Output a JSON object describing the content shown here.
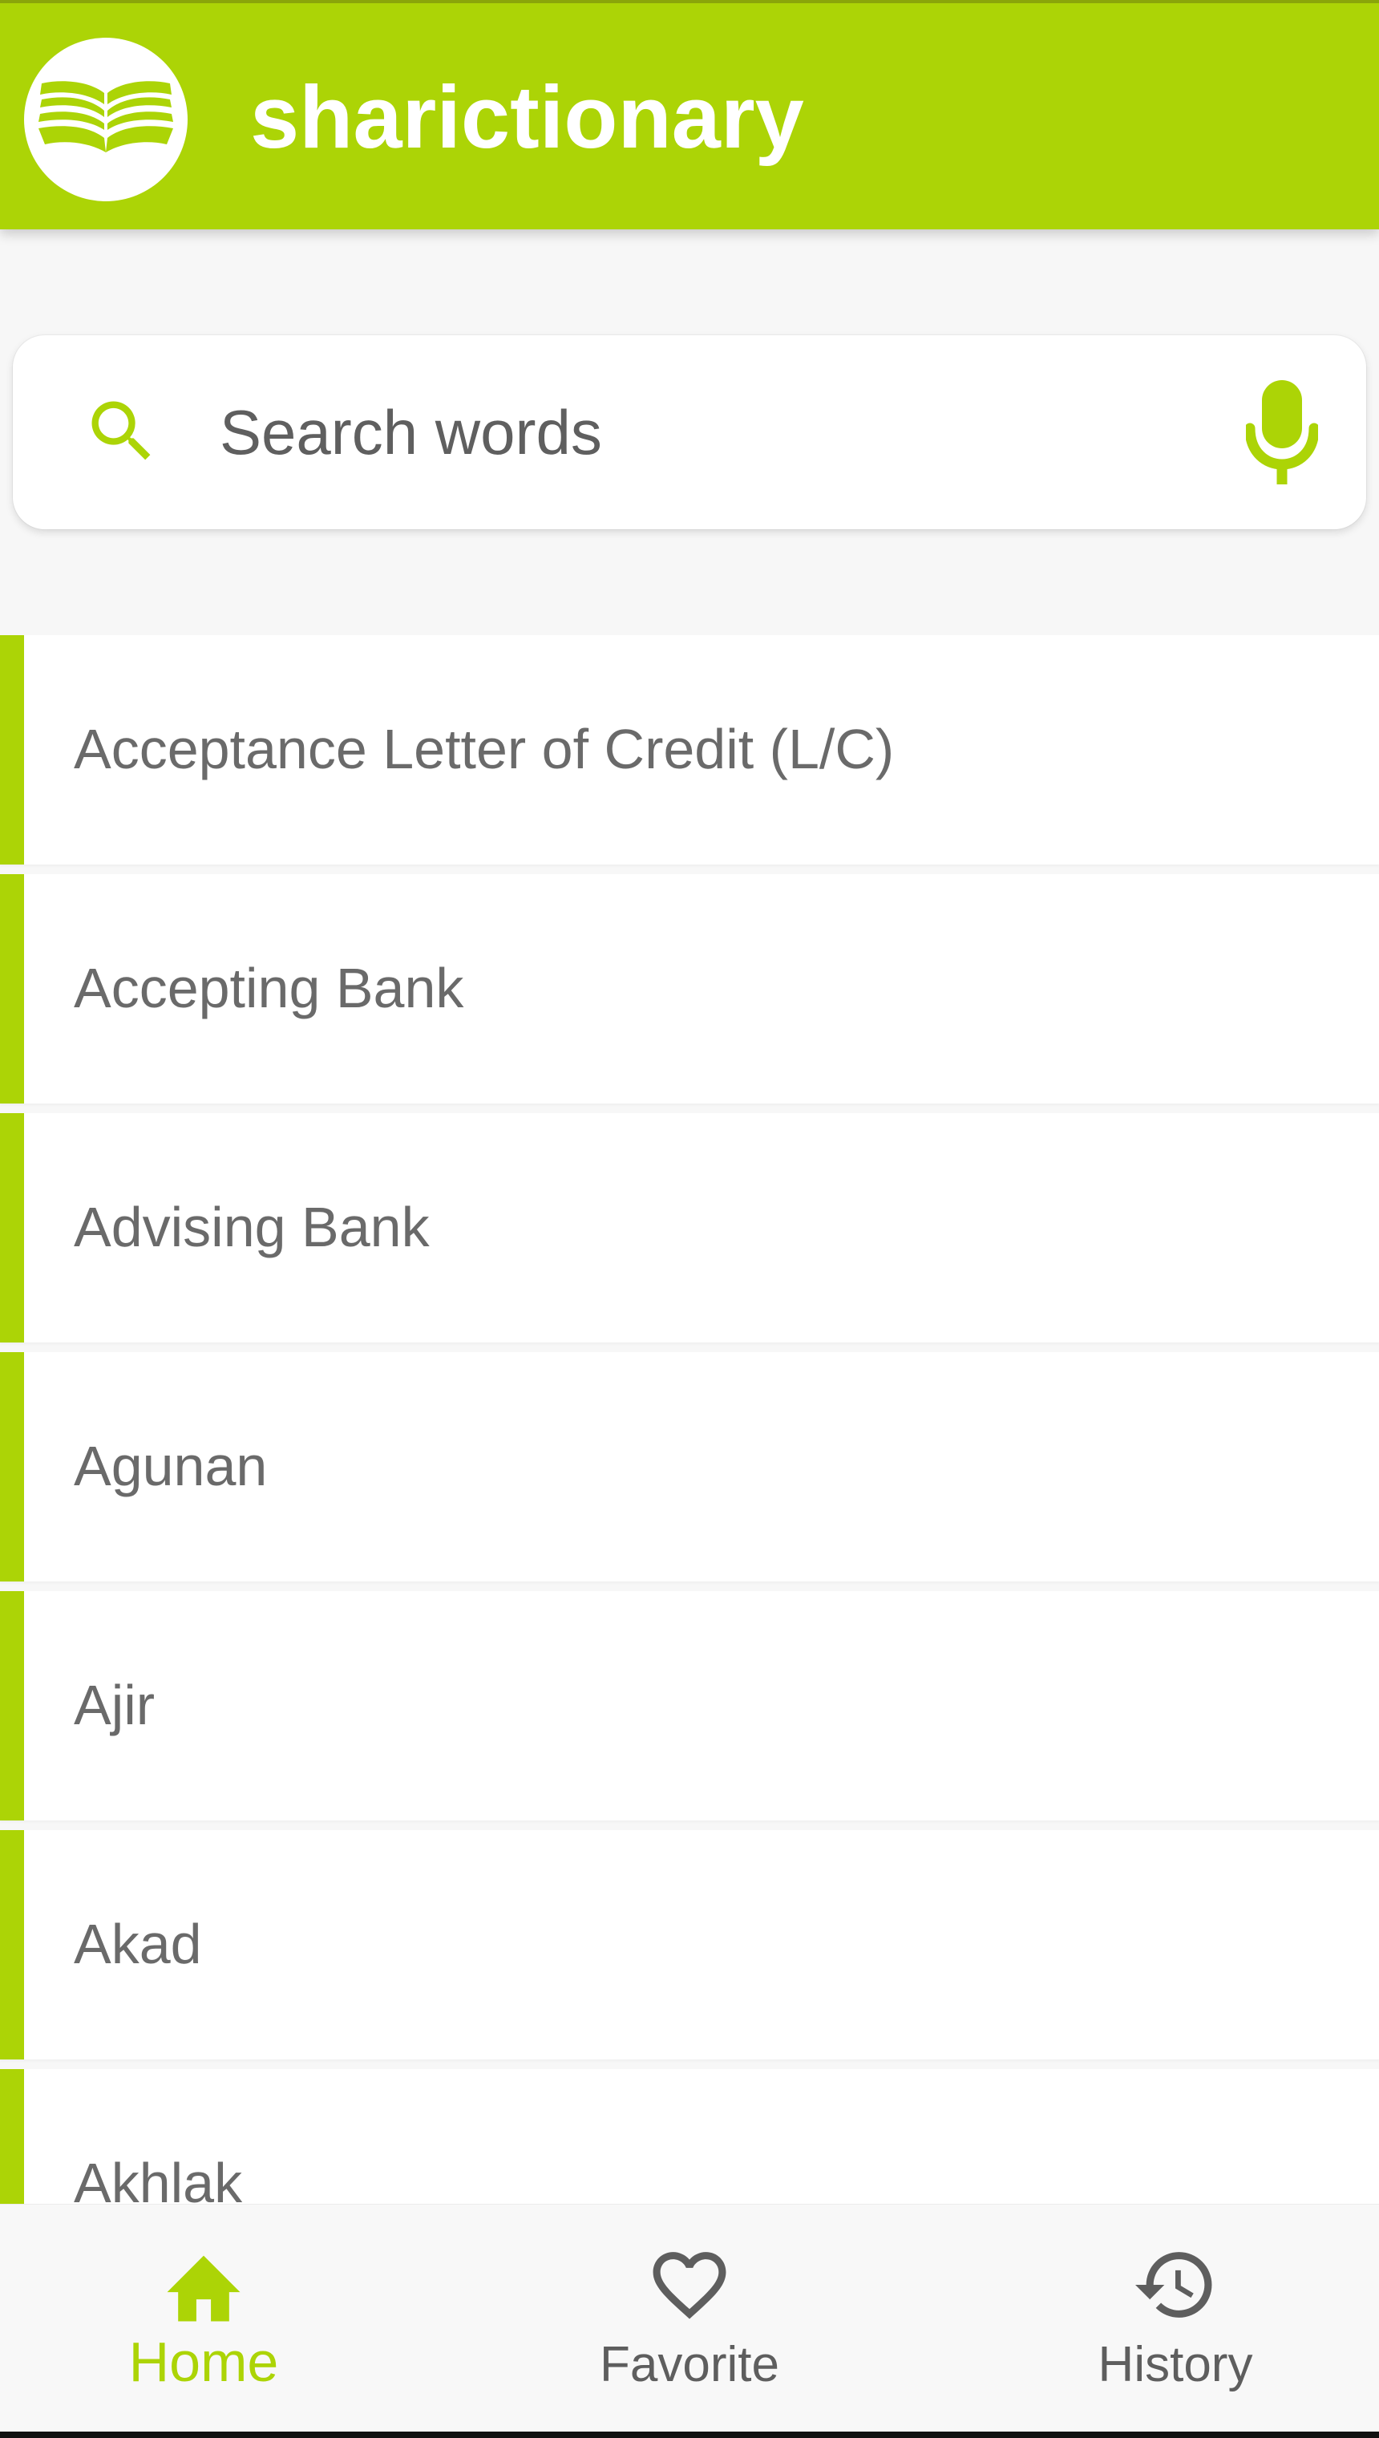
{
  "app": {
    "title": "sharictionary",
    "logo_icon": "open-book-icon",
    "accent_color": "#acd406"
  },
  "search": {
    "placeholder": "Search words",
    "value": "",
    "search_icon": "search-icon",
    "mic_icon": "microphone-icon"
  },
  "words": [
    {
      "label": "Acceptance Letter of Credit (L/C)"
    },
    {
      "label": "Accepting Bank"
    },
    {
      "label": "Advising Bank"
    },
    {
      "label": "Agunan"
    },
    {
      "label": "Ajir"
    },
    {
      "label": "Akad"
    },
    {
      "label": "Akhlak"
    }
  ],
  "nav": {
    "active": "home",
    "items": [
      {
        "key": "home",
        "label": "Home",
        "icon": "home-icon"
      },
      {
        "key": "favorite",
        "label": "Favorite",
        "icon": "heart-icon"
      },
      {
        "key": "history",
        "label": "History",
        "icon": "history-icon"
      }
    ]
  }
}
